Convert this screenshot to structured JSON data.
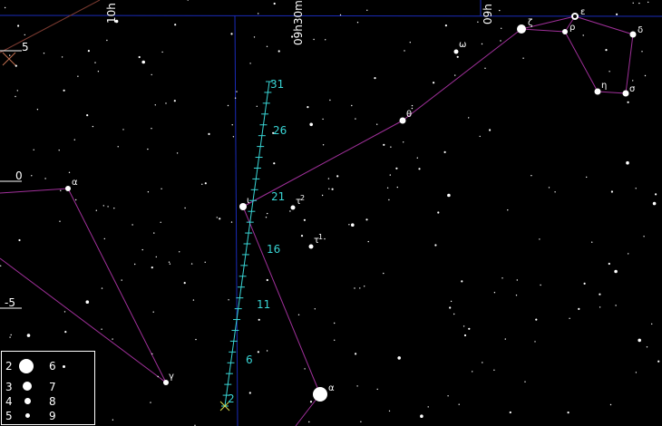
{
  "grid": {
    "ra_labels": [
      "10h",
      "09h30m",
      "09h"
    ],
    "dec_labels": [
      "5",
      "0",
      "-5"
    ]
  },
  "track": {
    "day_labels": [
      "31",
      "26",
      "21",
      "16",
      "11",
      "6",
      "2"
    ]
  },
  "stars": {
    "greek": [
      "ζ",
      "ε",
      "δ",
      "ρ",
      "ω",
      "η",
      "σ",
      "θ",
      "α",
      "ι",
      "τ",
      "2",
      "τ",
      "1",
      "γ",
      "α"
    ]
  },
  "legend": {
    "items": [
      {
        "mag": "2"
      },
      {
        "mag": "6"
      },
      {
        "mag": "3"
      },
      {
        "mag": "7"
      },
      {
        "mag": "4"
      },
      {
        "mag": "8"
      },
      {
        "mag": "5"
      },
      {
        "mag": "9"
      }
    ]
  },
  "colors": {
    "background": "#000000",
    "grid": "#1a2bb8",
    "constellation": "#a0309a",
    "track": "#39d5d5",
    "star": "#ffffff"
  }
}
